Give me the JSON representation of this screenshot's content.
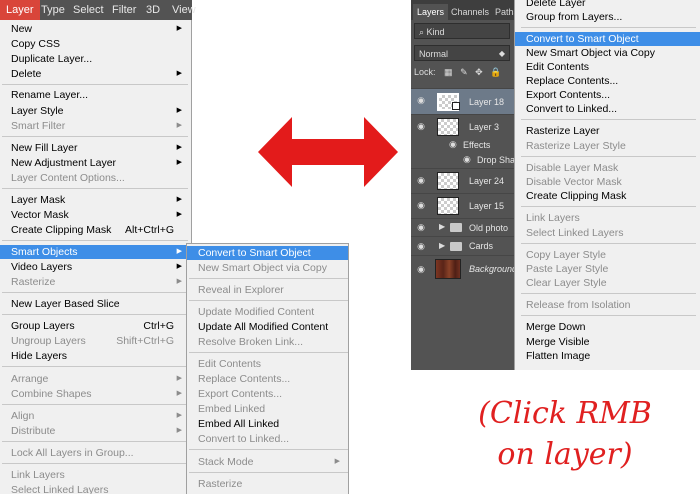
{
  "menubar": {
    "items": [
      "Layer",
      "Type",
      "Select",
      "Filter",
      "3D",
      "View"
    ]
  },
  "layer_menu": {
    "new": "New",
    "copy_css": "Copy CSS",
    "duplicate_layer": "Duplicate Layer...",
    "delete": "Delete",
    "rename_layer": "Rename Layer...",
    "layer_style": "Layer Style",
    "smart_filter": "Smart Filter",
    "new_fill_layer": "New Fill Layer",
    "new_adjustment_layer": "New Adjustment Layer",
    "layer_content_options": "Layer Content Options...",
    "layer_mask": "Layer Mask",
    "vector_mask": "Vector Mask",
    "create_clipping_mask": "Create Clipping Mask",
    "create_clipping_mask_shortcut": "Alt+Ctrl+G",
    "smart_objects": "Smart Objects",
    "video_layers": "Video Layers",
    "rasterize": "Rasterize",
    "new_layer_based_slice": "New Layer Based Slice",
    "group_layers": "Group Layers",
    "group_layers_shortcut": "Ctrl+G",
    "ungroup_layers": "Ungroup Layers",
    "ungroup_layers_shortcut": "Shift+Ctrl+G",
    "hide_layers": "Hide Layers",
    "arrange": "Arrange",
    "combine_shapes": "Combine Shapes",
    "align": "Align",
    "distribute": "Distribute",
    "lock_all_layers_in_group": "Lock All Layers in Group...",
    "link_layers": "Link Layers",
    "select_linked_layers": "Select Linked Layers"
  },
  "smart_objects_submenu": {
    "convert_to_smart_object": "Convert to Smart Object",
    "new_smart_object_via_copy": "New Smart Object via Copy",
    "reveal_in_explorer": "Reveal in Explorer",
    "update_modified_content": "Update Modified Content",
    "update_all_modified_content": "Update All Modified Content",
    "resolve_broken_link": "Resolve Broken Link...",
    "edit_contents": "Edit Contents",
    "replace_contents": "Replace Contents...",
    "export_contents": "Export Contents...",
    "embed_linked": "Embed Linked",
    "embed_all_linked": "Embed All Linked",
    "convert_to_linked": "Convert to Linked...",
    "stack_mode": "Stack Mode",
    "rasterize": "Rasterize"
  },
  "layers_panel": {
    "tabs": [
      "Layers",
      "Channels",
      "Paths"
    ],
    "filter_kind": "Kind",
    "blend_mode": "Normal",
    "lock_label": "Lock:",
    "layers": [
      {
        "name": "Layer 18"
      },
      {
        "name": "Layer 3"
      },
      {
        "name": "Effects"
      },
      {
        "name": "Drop Shadow"
      },
      {
        "name": "Layer 24"
      },
      {
        "name": "Layer 15"
      },
      {
        "name": "Old photo"
      },
      {
        "name": "Cards"
      },
      {
        "name": "Background"
      }
    ]
  },
  "context_menu": {
    "delete_layer": "Delete Layer",
    "group_from_layers": "Group from Layers...",
    "convert_to_smart_object": "Convert to Smart Object",
    "new_smart_object_via_copy": "New Smart Object via Copy",
    "edit_contents": "Edit Contents",
    "replace_contents": "Replace Contents...",
    "export_contents": "Export Contents...",
    "convert_to_linked": "Convert to Linked...",
    "rasterize_layer": "Rasterize Layer",
    "rasterize_layer_style": "Rasterize Layer Style",
    "disable_layer_mask": "Disable Layer Mask",
    "disable_vector_mask": "Disable Vector Mask",
    "create_clipping_mask": "Create Clipping Mask",
    "link_layers": "Link Layers",
    "select_linked_layers": "Select Linked Layers",
    "copy_layer_style": "Copy Layer Style",
    "paste_layer_style": "Paste Layer Style",
    "clear_layer_style": "Clear Layer Style",
    "release_from_isolation": "Release from Isolation",
    "merge_down": "Merge Down",
    "merge_visible": "Merge Visible",
    "flatten_image": "Flatten Image"
  },
  "caption": {
    "line1": "(Click RMB",
    "line2": "on layer)"
  },
  "colors": {
    "highlight": "#3e8ee7",
    "arrow": "#e31b1b",
    "caption": "#e02020",
    "panel_bg": "#535353"
  }
}
